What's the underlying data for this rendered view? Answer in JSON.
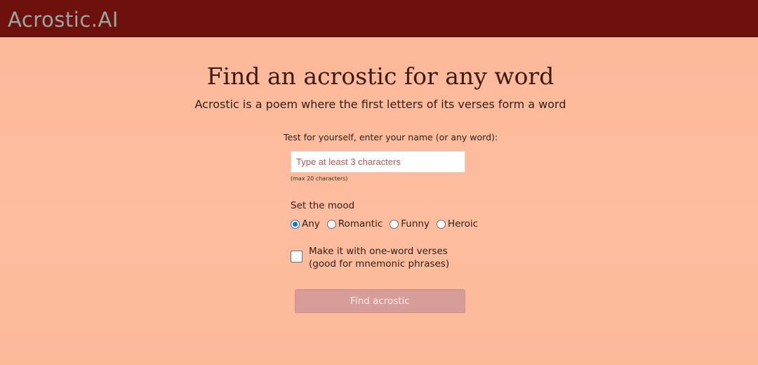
{
  "header": {
    "logo": "Acrostic.AI",
    "background_color": "#6e100c"
  },
  "main": {
    "title": "Find an acrostic for any word",
    "subtitle": "Acrostic is a poem where the first letters of its verses form a word",
    "prompt": "Test for yourself, enter your name (or any word):",
    "word_input": {
      "value": "",
      "placeholder": "Type at least 3 characters"
    },
    "input_hint": "(max 20 characters)",
    "mood": {
      "label": "Set the mood",
      "options": [
        {
          "label": "Any",
          "checked": true
        },
        {
          "label": "Romantic",
          "checked": false
        },
        {
          "label": "Funny",
          "checked": false
        },
        {
          "label": "Heroic",
          "checked": false
        }
      ]
    },
    "one_word": {
      "line1": "Make it with one-word verses",
      "line2": "(good for mnemonic phrases)",
      "checked": false
    },
    "submit_label": "Find acrostic",
    "accent_color": "#1e6fd9",
    "background_color": "#fdbb9b"
  }
}
